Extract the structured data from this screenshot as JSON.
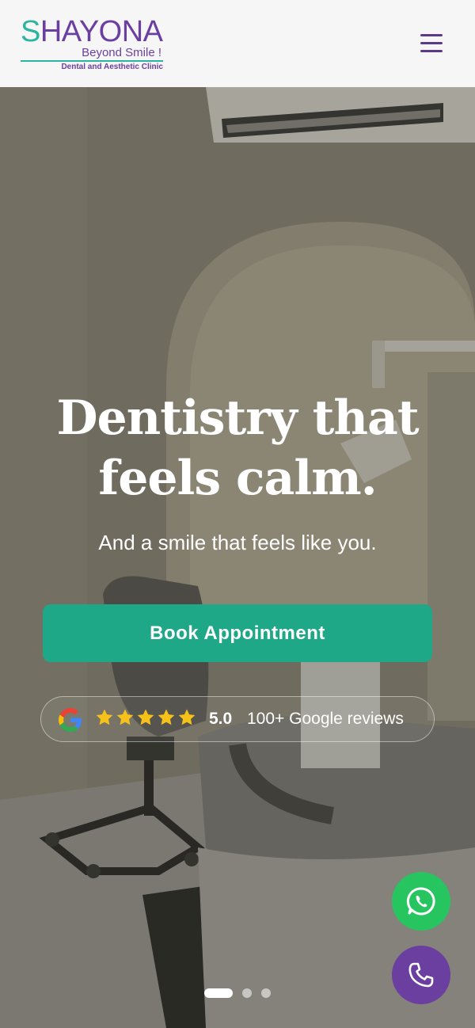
{
  "header": {
    "logo": {
      "name_first_letter": "S",
      "name_rest": "HAYONA",
      "tagline": "Beyond Smile !",
      "subtitle": "Dental and Aesthetic Clinic"
    },
    "menu_icon": "hamburger-menu-icon"
  },
  "hero": {
    "headline_line1": "Dentistry that",
    "headline_line2": "feels calm.",
    "subheadline": "And a smile that feels like you.",
    "cta_label": "Book Appointment",
    "reviews": {
      "rating": "5.0",
      "stars": 5,
      "label": "100+ Google reviews",
      "icon": "google-icon"
    },
    "carousel": {
      "slides": 3,
      "active": 0
    }
  },
  "floating_actions": {
    "whatsapp_icon": "whatsapp-icon",
    "phone_icon": "phone-icon"
  },
  "colors": {
    "brand_purple": "#6a3fa0",
    "brand_teal": "#2bb5a0",
    "cta_green": "#1fa887",
    "whatsapp_green": "#27c55f",
    "star_yellow": "#f6c21a"
  }
}
